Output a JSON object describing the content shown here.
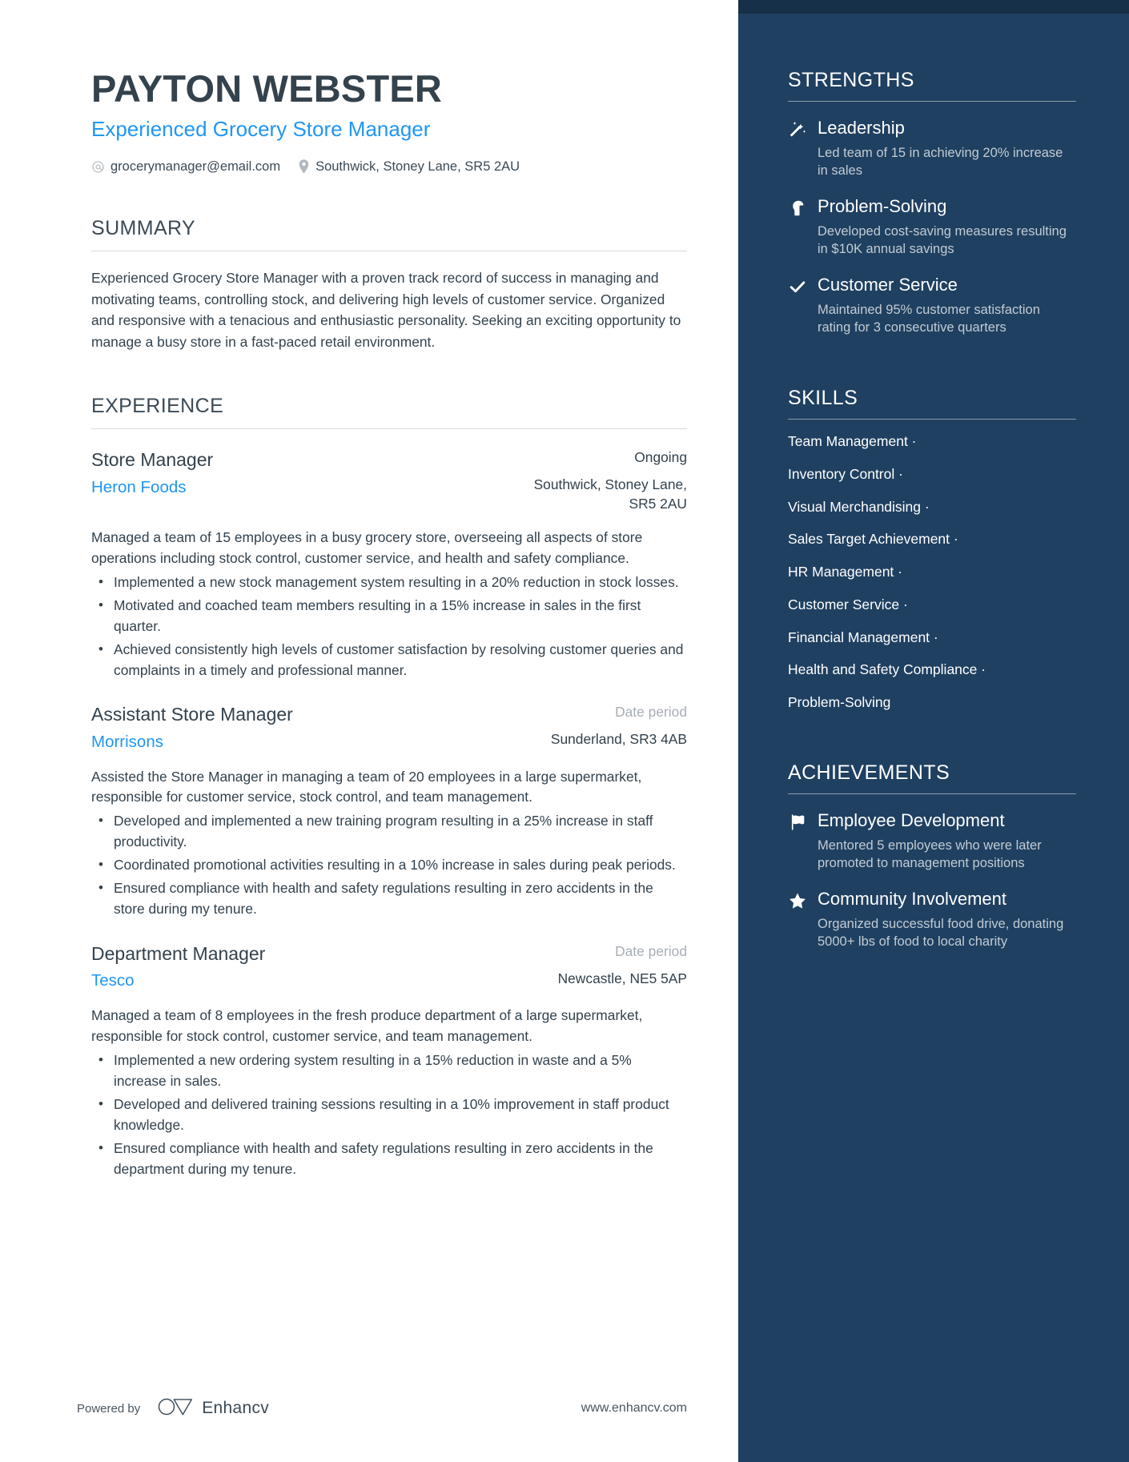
{
  "header": {
    "name": "PAYTON WEBSTER",
    "title": "Experienced Grocery Store Manager",
    "email": "grocerymanager@email.com",
    "location": "Southwick, Stoney Lane, SR5 2AU"
  },
  "summary": {
    "heading": "SUMMARY",
    "text": "Experienced Grocery Store Manager with a proven track record of success in managing and motivating teams, controlling stock, and delivering high levels of customer service. Organized and responsive with a tenacious and enthusiastic personality. Seeking an exciting opportunity to manage a busy store in a fast-paced retail environment."
  },
  "experience": {
    "heading": "EXPERIENCE",
    "jobs": [
      {
        "role": "Store Manager",
        "company": "Heron Foods",
        "date": "Ongoing",
        "date_muted": false,
        "location": "Southwick, Stoney Lane, SR5 2AU",
        "description": "Managed a team of 15 employees in a busy grocery store, overseeing all aspects of store operations including stock control, customer service, and health and safety compliance.",
        "bullets": [
          "Implemented a new stock management system resulting in a 20% reduction in stock losses.",
          "Motivated and coached team members resulting in a 15% increase in sales in the first quarter.",
          "Achieved consistently high levels of customer satisfaction by resolving customer queries and complaints in a timely and professional manner."
        ]
      },
      {
        "role": "Assistant Store Manager",
        "company": "Morrisons",
        "date": "Date period",
        "date_muted": true,
        "location": "Sunderland, SR3 4AB",
        "description": "Assisted the Store Manager in managing a team of 20 employees in a large supermarket, responsible for customer service, stock control, and team management.",
        "bullets": [
          "Developed and implemented a new training program resulting in a 25% increase in staff productivity.",
          "Coordinated promotional activities resulting in a 10% increase in sales during peak periods.",
          "Ensured compliance with health and safety regulations resulting in zero accidents in the store during my tenure."
        ]
      },
      {
        "role": "Department Manager",
        "company": "Tesco",
        "date": "Date period",
        "date_muted": true,
        "location": "Newcastle, NE5 5AP",
        "description": "Managed a team of 8 employees in the fresh produce department of a large supermarket, responsible for stock control, customer service, and team management.",
        "bullets": [
          "Implemented a new ordering system resulting in a 15% reduction in waste and a 5% increase in sales.",
          "Developed and delivered training sessions resulting in a 10% improvement in staff product knowledge.",
          "Ensured compliance with health and safety regulations resulting in zero accidents in the department during my tenure."
        ]
      }
    ]
  },
  "strengths": {
    "heading": "STRENGTHS",
    "items": [
      {
        "icon": "magic-wand-icon",
        "title": "Leadership",
        "desc": "Led team of 15 in achieving 20% increase in sales"
      },
      {
        "icon": "lightbulb-head-icon",
        "title": "Problem-Solving",
        "desc": "Developed cost-saving measures resulting in $10K annual savings"
      },
      {
        "icon": "check-icon",
        "title": "Customer Service",
        "desc": "Maintained 95% customer satisfaction rating for 3 consecutive quarters"
      }
    ]
  },
  "skills": {
    "heading": "SKILLS",
    "separator": "·",
    "items": [
      "Team Management",
      "Inventory Control",
      "Visual Merchandising",
      "Sales Target Achievement",
      "HR Management",
      "Customer Service",
      "Financial Management",
      "Health and Safety Compliance",
      "Problem-Solving"
    ]
  },
  "achievements": {
    "heading": "ACHIEVEMENTS",
    "items": [
      {
        "icon": "flag-icon",
        "title": "Employee Development",
        "desc": "Mentored 5 employees who were later promoted to management positions"
      },
      {
        "icon": "star-icon",
        "title": "Community Involvement",
        "desc": "Organized successful food drive, donating 5000+ lbs of food to local charity"
      }
    ]
  },
  "footer": {
    "powered_by": "Powered by",
    "brand": "Enhancv",
    "url": "www.enhancv.com"
  },
  "colors": {
    "accent_blue": "#2196f3",
    "sidebar_bg": "#1f4061",
    "sidebar_strip": "#16304a",
    "heading_text": "#33424d"
  }
}
